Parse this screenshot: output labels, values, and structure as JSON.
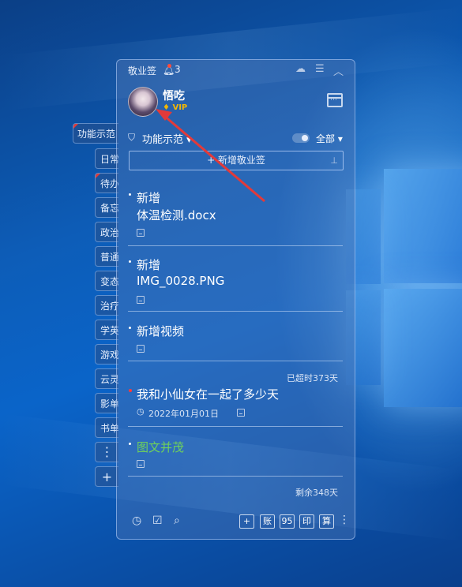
{
  "side_tabs": {
    "items": [
      "功能示范",
      "日常",
      "待办",
      "备忘",
      "政治",
      "普通",
      "变态",
      "治疗",
      "学英",
      "游戏",
      "云灵",
      "影单",
      "书单"
    ],
    "more": "⋮",
    "add": "+"
  },
  "app": {
    "title": "敬业签",
    "notification_count": "3"
  },
  "user": {
    "name": "悟吃",
    "badge": "VIP"
  },
  "section": {
    "title": "功能示范",
    "filter": "全部"
  },
  "add_button": {
    "label": "+ 新增敬业签"
  },
  "notes": [
    {
      "line1": "新增",
      "line2": "体温检测.docx"
    },
    {
      "line1": "新增",
      "line2": "IMG_0028.PNG"
    },
    {
      "line1": "新增视频"
    },
    {
      "status": "已超时373天",
      "text": "我和小仙女在一起了多少天",
      "date": "2022年01月01日"
    },
    {
      "text": "图文并茂"
    },
    {
      "status": "剩余348天"
    }
  ],
  "toolbar": {
    "buttons": [
      "+",
      "账",
      "95",
      "印",
      "算"
    ]
  },
  "colors": {
    "accent_red": "#e03a3a",
    "vip_gold": "#f2b705",
    "green_text": "#6fd15b"
  }
}
